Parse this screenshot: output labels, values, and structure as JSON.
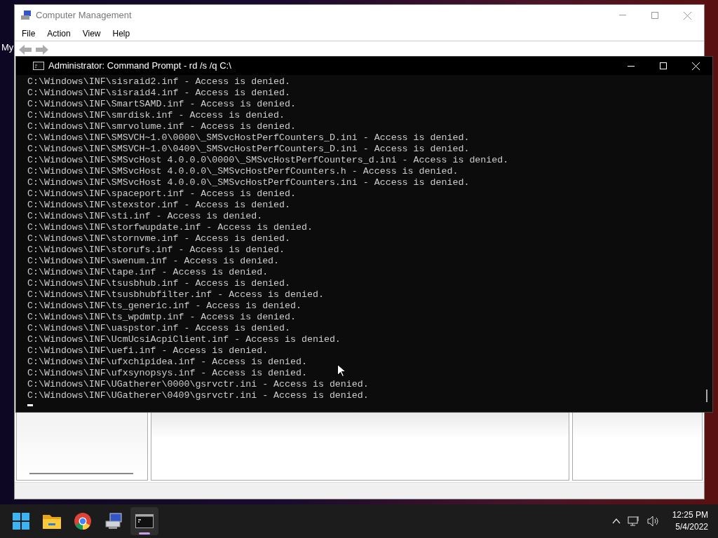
{
  "desktop": {
    "label": "My"
  },
  "background_window": {
    "title": "Computer Management",
    "menu": [
      "File",
      "Action",
      "View",
      "Help"
    ]
  },
  "console": {
    "title": "Administrator: Command Prompt - rd  /s /q C:\\",
    "lines": [
      "C:\\Windows\\INF\\sisraid2.inf - Access is denied.",
      "C:\\Windows\\INF\\sisraid4.inf - Access is denied.",
      "C:\\Windows\\INF\\SmartSAMD.inf - Access is denied.",
      "C:\\Windows\\INF\\smrdisk.inf - Access is denied.",
      "C:\\Windows\\INF\\smrvolume.inf - Access is denied.",
      "C:\\Windows\\INF\\SMSVCH~1.0\\0000\\_SMSvcHostPerfCounters_D.ini - Access is denied.",
      "C:\\Windows\\INF\\SMSVCH~1.0\\0409\\_SMSvcHostPerfCounters_D.ini - Access is denied.",
      "C:\\Windows\\INF\\SMSvcHost 4.0.0.0\\0000\\_SMSvcHostPerfCounters_d.ini - Access is denied.",
      "C:\\Windows\\INF\\SMSvcHost 4.0.0.0\\_SMSvcHostPerfCounters.h - Access is denied.",
      "C:\\Windows\\INF\\SMSvcHost 4.0.0.0\\_SMSvcHostPerfCounters.ini - Access is denied.",
      "C:\\Windows\\INF\\spaceport.inf - Access is denied.",
      "C:\\Windows\\INF\\stexstor.inf - Access is denied.",
      "C:\\Windows\\INF\\sti.inf - Access is denied.",
      "C:\\Windows\\INF\\storfwupdate.inf - Access is denied.",
      "C:\\Windows\\INF\\stornvme.inf - Access is denied.",
      "C:\\Windows\\INF\\storufs.inf - Access is denied.",
      "C:\\Windows\\INF\\swenum.inf - Access is denied.",
      "C:\\Windows\\INF\\tape.inf - Access is denied.",
      "C:\\Windows\\INF\\tsusbhub.inf - Access is denied.",
      "C:\\Windows\\INF\\tsusbhubfilter.inf - Access is denied.",
      "C:\\Windows\\INF\\ts_generic.inf - Access is denied.",
      "C:\\Windows\\INF\\ts_wpdmtp.inf - Access is denied.",
      "C:\\Windows\\INF\\uaspstor.inf - Access is denied.",
      "C:\\Windows\\INF\\UcmUcsiAcpiClient.inf - Access is denied.",
      "C:\\Windows\\INF\\uefi.inf - Access is denied.",
      "C:\\Windows\\INF\\ufxchipidea.inf - Access is denied.",
      "C:\\Windows\\INF\\ufxsynopsys.inf - Access is denied.",
      "C:\\Windows\\INF\\UGatherer\\0000\\gsrvctr.ini - Access is denied.",
      "C:\\Windows\\INF\\UGatherer\\0409\\gsrvctr.ini - Access is denied."
    ]
  },
  "taskbar": {
    "apps": [
      {
        "kind": "start",
        "selected": false
      },
      {
        "kind": "folder",
        "selected": false
      },
      {
        "kind": "browser",
        "selected": false
      },
      {
        "kind": "management",
        "selected": false
      },
      {
        "kind": "terminal",
        "selected": true
      }
    ],
    "time": "12:25 PM",
    "date": "5/4/2022"
  }
}
